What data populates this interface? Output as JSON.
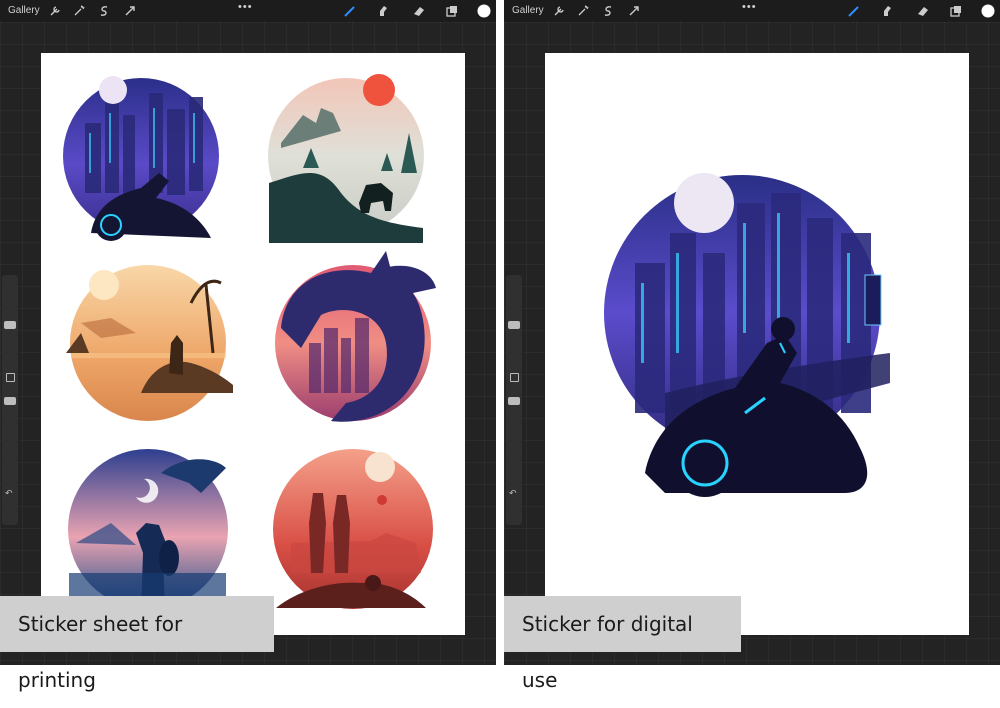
{
  "left_panel": {
    "toolbar": {
      "gallery_label": "Gallery",
      "left_icons": [
        "wrench-icon",
        "magic-wand-icon",
        "selection-s-icon",
        "arrow-cursor-icon"
      ],
      "right_icons": [
        "brush-icon",
        "smudge-icon",
        "eraser-icon",
        "layers-icon",
        "color-swatch-icon"
      ],
      "more_label": "•••"
    },
    "stickers": [
      "cyberpunk-motorcycle-sticker",
      "mountain-castle-sticker",
      "desert-wanderer-sticker",
      "wolf-city-sticker",
      "viking-eagle-sticker",
      "desert-planet-sticker"
    ],
    "caption": "Sticker sheet for printing"
  },
  "right_panel": {
    "toolbar": {
      "gallery_label": "Gallery",
      "left_icons": [
        "wrench-icon",
        "magic-wand-icon",
        "selection-s-icon",
        "arrow-cursor-icon"
      ],
      "right_icons": [
        "brush-icon",
        "smudge-icon",
        "eraser-icon",
        "layers-icon",
        "color-swatch-icon"
      ],
      "more_label": "•••"
    },
    "sticker": "cyberpunk-motorcycle-sticker-large",
    "caption": "Sticker for digital use"
  },
  "colors": {
    "brush_active": "#2f8cff",
    "background": "#232323",
    "caption_bg": "#cfcfcf"
  }
}
